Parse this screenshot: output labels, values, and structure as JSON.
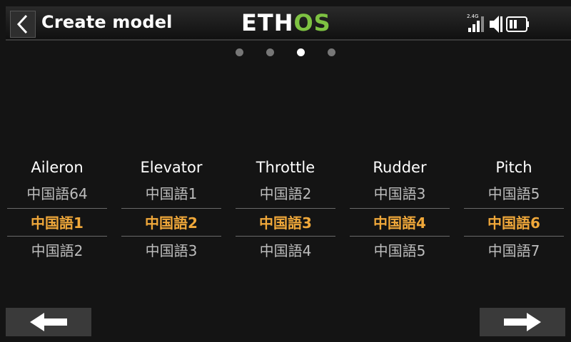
{
  "header": {
    "title": "Create model",
    "logo_prefix": "ETH",
    "logo_suffix": "OS",
    "signal_label": "2.4G"
  },
  "pager": {
    "count": 4,
    "active_index": 2
  },
  "columns": [
    {
      "title": "Aileron",
      "prev": "中国語64",
      "selected": "中国語1",
      "next": "中国語2"
    },
    {
      "title": "Elevator",
      "prev": "中国語1",
      "selected": "中国語2",
      "next": "中国語3"
    },
    {
      "title": "Throttle",
      "prev": "中国語2",
      "selected": "中国語3",
      "next": "中国語4"
    },
    {
      "title": "Rudder",
      "prev": "中国語3",
      "selected": "中国語4",
      "next": "中国語5"
    },
    {
      "title": "Pitch",
      "prev": "中国語5",
      "selected": "中国語6",
      "next": "中国語7"
    }
  ],
  "icons": {
    "back": "chevron-left-icon",
    "signal": "signal-bars-icon",
    "volume": "speaker-muted-icon",
    "battery": "battery-icon",
    "prev": "arrow-left-icon",
    "next": "arrow-right-icon"
  },
  "colors": {
    "accent": "#f0a83a",
    "logo_green": "#7ec242"
  }
}
